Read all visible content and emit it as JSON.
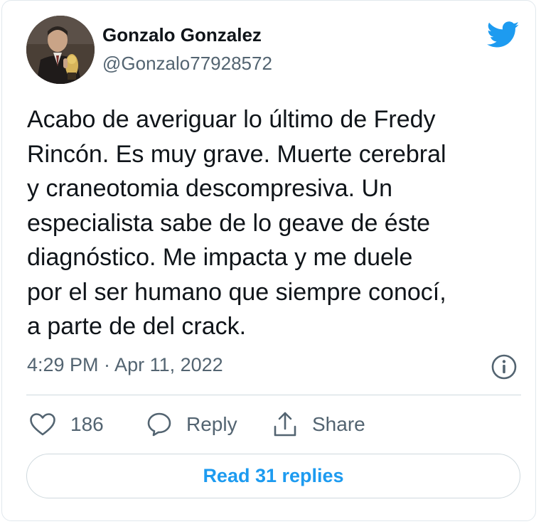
{
  "author": {
    "display_name": "Gonzalo Gonzalez",
    "handle": "@Gonzalo77928572"
  },
  "tweet": {
    "lines": [
      "Acabo de averiguar lo último de Fredy",
      "Rincón. Es muy grave. Muerte cerebral",
      "y craneotomia descompresiva. Un",
      "especialista sabe de lo geave de éste",
      "diagnóstico. Me impacta y me duele",
      "por el ser humano que siempre conocí,",
      "a parte de del crack."
    ],
    "timestamp": "4:29 PM · Apr 11, 2022"
  },
  "actions": {
    "like_count": "186",
    "reply_label": "Reply",
    "share_label": "Share"
  },
  "read_replies_label": "Read 31 replies",
  "icons": {
    "brand": "twitter-bird-icon",
    "info": "info-icon",
    "like": "heart-icon",
    "reply": "speech-bubble-icon",
    "share": "share-upload-icon"
  },
  "colors": {
    "twitter_blue": "#1d9bf0",
    "text_primary": "#0f1419",
    "text_secondary": "#536471",
    "border": "#cfd9de"
  }
}
